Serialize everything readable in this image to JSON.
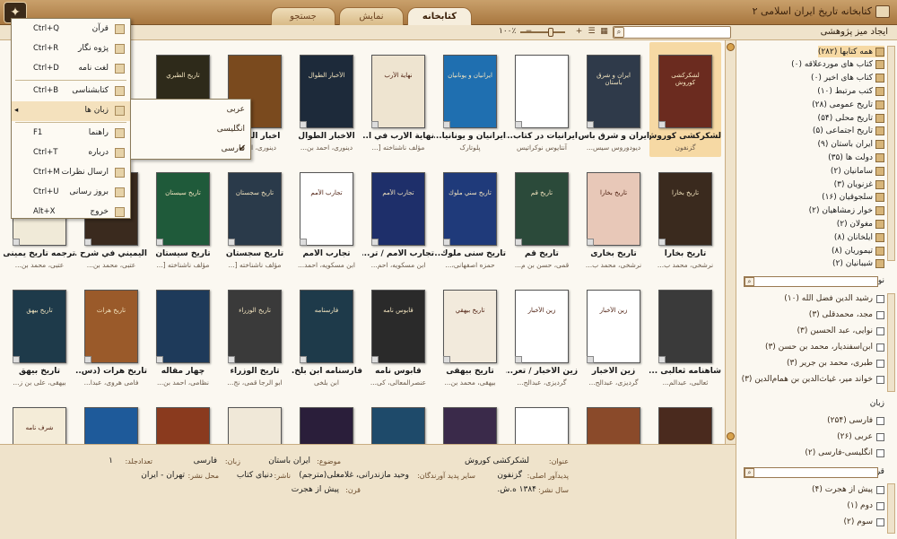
{
  "window": {
    "title": "کتابخانه تاریخ ایران اسلامی ۲",
    "tabs": [
      "کتابخانه",
      "نمایش",
      "جستجو"
    ],
    "active_tab": 0
  },
  "toolbar": {
    "create_desk_label": "ایجاد میز پژوهشی",
    "zoom_label": "۱۰۰٪"
  },
  "menu": {
    "items": [
      {
        "label": "قرآن",
        "shortcut": "Ctrl+Q"
      },
      {
        "label": "پژوه نگار",
        "shortcut": "Ctrl+R"
      },
      {
        "label": "لغت نامه",
        "shortcut": "Ctrl+D"
      },
      {
        "label": "کتابشناسی",
        "shortcut": "Ctrl+B"
      },
      {
        "label": "زبان ها",
        "shortcut": ""
      },
      {
        "label": "راهنما",
        "shortcut": "F1"
      },
      {
        "label": "درباره",
        "shortcut": "Ctrl+T"
      },
      {
        "label": "ارسال نظرات",
        "shortcut": "Ctrl+M"
      },
      {
        "label": "بروز رسانی",
        "shortcut": "Ctrl+U"
      },
      {
        "label": "خروج",
        "shortcut": "Alt+X"
      }
    ],
    "language_submenu": [
      {
        "label": "عربی",
        "checked": false
      },
      {
        "label": "انگلیسی",
        "checked": false
      },
      {
        "label": "فارسی",
        "checked": true
      }
    ]
  },
  "books": [
    [
      {
        "title": "لشکرکشی کوروش",
        "author": "گزنفون",
        "color": "#6b2b1f",
        "cover_text": "لشکرکشی کوروش"
      },
      {
        "title": "ایران و شرق باس...",
        "author": "دیودوروس سیس...",
        "color": "#2f3a4a",
        "cover_text": "ایران و شرق باستان"
      },
      {
        "title": "ایرانیات در کتاب...",
        "author": "آنتایوس نوکراتیس",
        "color": "#ffffff",
        "cover_text": ""
      },
      {
        "title": "ایرانیان و یونانیا...",
        "author": "پلوتارک",
        "color": "#1f6fb0",
        "cover_text": "ایرانیان و یونانیان"
      },
      {
        "title": "نهایة الأرب في أ...",
        "author": "مؤلف ناشناخته [...",
        "color": "#eee4d0",
        "cover_text": "نهاية الأرب"
      },
      {
        "title": "الأخبار الطوال",
        "author": "دینوری، احمد بن...",
        "color": "#1d2a3a",
        "cover_text": "الأخبار الطوال"
      },
      {
        "title": "أخبار الطوال",
        "author": "دینوری، احمد...",
        "color": "#7a4a1e",
        "cover_text": ""
      },
      {
        "title": "",
        "author": "",
        "color": "#2e2a1a",
        "cover_text": "تاريخ الطبري"
      }
    ],
    [
      {
        "title": "تاریخ بخارا",
        "author": "نرشخی، محمد ب...",
        "color": "#3a2a1e",
        "cover_text": "تاريخ بخارا"
      },
      {
        "title": "تاریخ بخاری",
        "author": "نرشخی، محمد ب...",
        "color": "#e8c8b8",
        "cover_text": "تاريخ بخارا"
      },
      {
        "title": "تاریخ قم",
        "author": "قمی، حسن بن م...",
        "color": "#2b4a3a",
        "cover_text": "تاريخ قم"
      },
      {
        "title": "تاریخ سنی ملوك...",
        "author": "حمزه اصفهانی،...",
        "color": "#1f3a7a",
        "cover_text": "تاريخ سني ملوك"
      },
      {
        "title": "تجارب الأمم / تر...",
        "author": "ابن مسکویه، احم...",
        "color": "#1e2f6a",
        "cover_text": "تجارب الأمم"
      },
      {
        "title": "تجارب الأمم",
        "author": "ابن مسکویه، احمد...",
        "color": "#ffffff",
        "cover_text": "تجارب الأمم"
      },
      {
        "title": "تاریخ سجستان",
        "author": "مؤلف ناشناخته [...",
        "color": "#2a3a4a",
        "cover_text": "تاريخ سجستان"
      },
      {
        "title": "تاریخ سیستان",
        "author": "مؤلف ناشناخته [...",
        "color": "#1f5a3a",
        "cover_text": "تاريخ سيستان"
      },
      {
        "title": "اليميني في شرح ...",
        "author": "عتبى، محمد بن...",
        "color": "#3a2a1e",
        "cover_text": ""
      },
      {
        "title": "ترجمه تاریخ یمینی",
        "author": "عتبى، محمد بن...",
        "color": "#f0ead8",
        "cover_text": ""
      }
    ],
    [
      {
        "title": "شاهنامه ثعالبی ...",
        "author": "ثعالبی، عبدالم...",
        "color": "#3a3a3a",
        "cover_text": ""
      },
      {
        "title": "زین الأخبار",
        "author": "گردیزی، عبدالح...",
        "color": "#ffffff",
        "cover_text": "زين الأخبار"
      },
      {
        "title": "زين الأخبار / تعر...",
        "author": "گردیزی، عبدالح...",
        "color": "#ffffff",
        "cover_text": "زين الأخبار"
      },
      {
        "title": "تاریخ بیهقی",
        "author": "بیهقی، محمد بن...",
        "color": "#f2eadc",
        "cover_text": "تاريخ بيهقي"
      },
      {
        "title": "قابوس نامه",
        "author": "عنصرالمعالی، کی...",
        "color": "#2a2a2a",
        "cover_text": "قابوس نامه"
      },
      {
        "title": "فارسنامه ابن بلخ...",
        "author": "ابن بلخی",
        "color": "#1e3a4a",
        "cover_text": "فارسنامه"
      },
      {
        "title": "تاریخ الوزراء",
        "author": "ابو الرجا قمی، نج...",
        "color": "#3a3a3a",
        "cover_text": "تاريخ الوزراء"
      },
      {
        "title": "چهار مقاله",
        "author": "نظامی، احمد بن...",
        "color": "#1e3a5a",
        "cover_text": ""
      },
      {
        "title": "تاریخ هرات (دس...",
        "author": "فامی هروی، عبدا...",
        "color": "#9a5a2a",
        "cover_text": "تاريخ هرات"
      },
      {
        "title": "تاریخ بیهق",
        "author": "بیهقی، علی بن ز...",
        "color": "#1e3a4a",
        "cover_text": "تاريخ بيهق"
      }
    ],
    [
      {
        "title": "",
        "author": "",
        "color": "#4a2a1e",
        "cover_text": ""
      },
      {
        "title": "",
        "author": "",
        "color": "#8a4a2a",
        "cover_text": ""
      },
      {
        "title": "",
        "author": "",
        "color": "#ffffff",
        "cover_text": ""
      },
      {
        "title": "",
        "author": "",
        "color": "#3a2a4a",
        "cover_text": ""
      },
      {
        "title": "",
        "author": "",
        "color": "#1e4a6a",
        "cover_text": ""
      },
      {
        "title": "",
        "author": "",
        "color": "#2a1e3a",
        "cover_text": ""
      },
      {
        "title": "",
        "author": "",
        "color": "#f0e8d8",
        "cover_text": ""
      },
      {
        "title": "",
        "author": "",
        "color": "#8a3a1e",
        "cover_text": ""
      },
      {
        "title": "",
        "author": "",
        "color": "#1e5a9a",
        "cover_text": ""
      },
      {
        "title": "",
        "author": "",
        "color": "#f4ecd8",
        "cover_text": "شرف نامه"
      }
    ]
  ],
  "info": {
    "title_label": "عنوان:",
    "title_value": "لشکرکشی کوروش",
    "subject_label": "موضوع:",
    "subject_value": "ایران باستان",
    "language_label": "زبان:",
    "language_value": "فارسی",
    "volumes_label": "تعدادجلد:",
    "volumes_value": "۱",
    "orig_author_label": "پدیدآور اصلی:",
    "orig_author_value": "گزنفون",
    "other_authors_label": "سایر پدید آورندگان:",
    "other_authors_value": "وحید مازندرانی، غلامعلی(مترجم)",
    "publisher_label": "ناشر:",
    "publisher_value": "دنیای کتاب",
    "place_label": "محل نشر:",
    "place_value": "تهران - ایران",
    "year_label": "سال نشر:",
    "year_value": "۱۳۸۴ ه.ش.",
    "century_label": "قرن:",
    "century_value": "پیش از هجرت"
  },
  "sidebar": {
    "categories": [
      "همه کتابها (۲۸۲)",
      "کتاب های موردعلاقه (۰)",
      "کتاب های اخیر (۰)",
      "کتب مرتبط (۱۰)",
      "تاریخ عمومی (۲۸)",
      "تاریخ محلی (۵۴)",
      "تاریخ اجتماعی (۵)",
      "ایران باستان (۹)",
      "دولت ها (۳۵)",
      "سامانیان (۲)",
      "غزنویان (۳)",
      "سلجوقیان (۱۶)",
      "خوار زمشاهیان (۲)",
      "مغولان (۲)",
      "ایلخانان (۸)",
      "تیموریان (۸)",
      "شیبانیان (۲)"
    ],
    "author_section": "نویسنده",
    "authors": [
      "رشید الدین فضل الله (۱۰)",
      "مجد، محمدقلی (۳)",
      "نوایی، عبد الحسین (۳)",
      "ابن‌اسفندیار، محمد بن حسن (۳)",
      "طبری، محمد بن جریر (۳)",
      "خواند میر، غیاث‌الدین بن همام‌الدین (۳)"
    ],
    "language_section": "زبان",
    "languages": [
      "فارسی (۲۵۴)",
      "عربی (۲۶)",
      "انگلیسی-فارسی (۲)"
    ],
    "century_section": "قرن",
    "centuries": [
      "پیش از هجرت (۴)",
      "دوم (۱)",
      "سوم (۲)"
    ]
  }
}
